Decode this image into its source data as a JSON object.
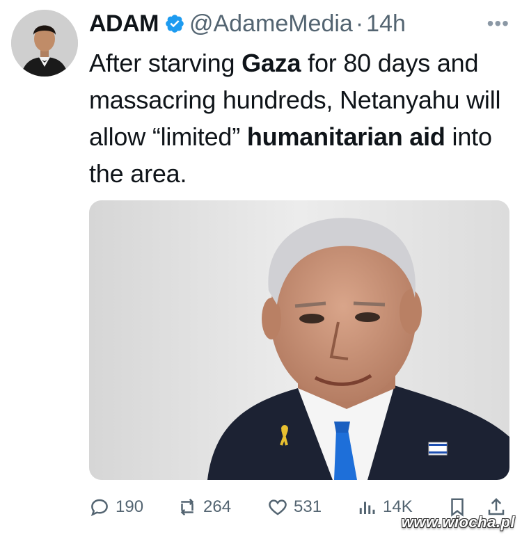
{
  "author": {
    "display_name": "ADAM",
    "handle": "@AdameMedia",
    "separator": "·",
    "time": "14h",
    "verified": true,
    "verified_color": "#1d9bf0"
  },
  "tweet": {
    "seg1": "After starving ",
    "seg2_bold": "Gaza",
    "seg3": " for 80 days and massacring hundreds, Netanyahu will allow “limited” ",
    "seg4_bold": "humanitarian aid",
    "seg5": " into the area."
  },
  "actions": {
    "replies": "190",
    "reposts": "264",
    "likes": "531",
    "views": "14K"
  },
  "watermark": "www.wiocha.pl",
  "icons": {
    "more": "more-icon",
    "reply": "reply-icon",
    "repost": "repost-icon",
    "like": "heart-icon",
    "views": "views-icon",
    "bookmark": "bookmark-icon",
    "share": "share-icon"
  }
}
